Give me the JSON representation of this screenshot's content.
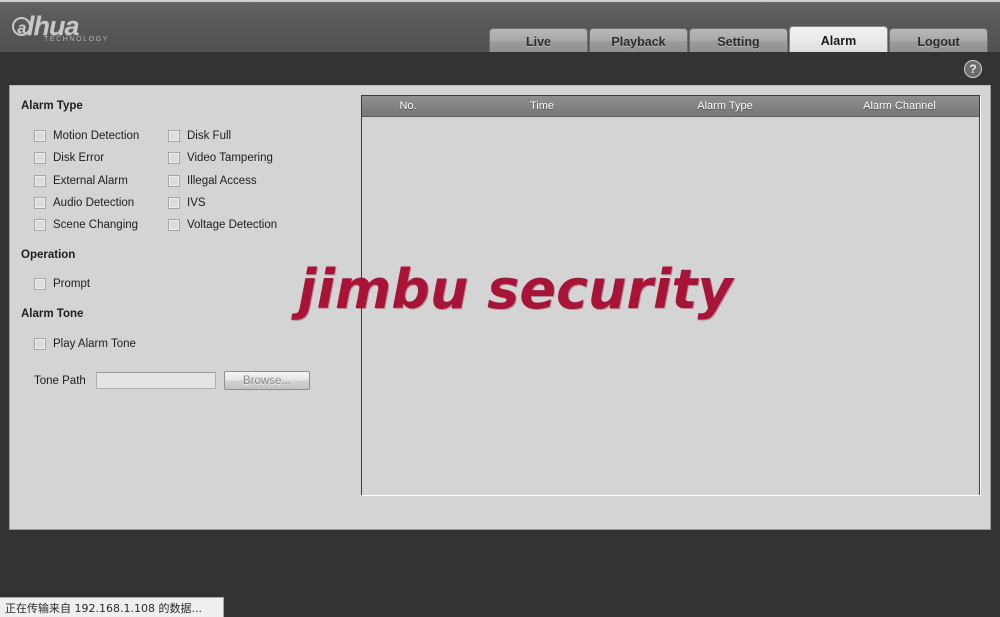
{
  "header": {
    "logo_mark": "a",
    "logo_name": "lhua",
    "logo_sub": "TECHNOLOGY",
    "help_icon": "?",
    "tabs": [
      {
        "label": "Live",
        "active": false
      },
      {
        "label": "Playback",
        "active": false
      },
      {
        "label": "Setting",
        "active": false
      },
      {
        "label": "Alarm",
        "active": true
      },
      {
        "label": "Logout",
        "active": false
      }
    ]
  },
  "left_pane": {
    "alarm_type_title": "Alarm Type",
    "alarm_types_col1": [
      {
        "label": "Motion Detection",
        "checked": false
      },
      {
        "label": "Disk Error",
        "checked": false
      },
      {
        "label": "External Alarm",
        "checked": false
      },
      {
        "label": "Audio Detection",
        "checked": false
      },
      {
        "label": "Scene Changing",
        "checked": false
      }
    ],
    "alarm_types_col2": [
      {
        "label": "Disk Full",
        "checked": false
      },
      {
        "label": "Video Tampering",
        "checked": false
      },
      {
        "label": "Illegal Access",
        "checked": false
      },
      {
        "label": "IVS",
        "checked": false
      },
      {
        "label": "Voltage Detection",
        "checked": false
      }
    ],
    "operation_title": "Operation",
    "prompt": {
      "label": "Prompt",
      "checked": false
    },
    "alarm_tone_title": "Alarm Tone",
    "play_alarm_tone": {
      "label": "Play Alarm Tone",
      "checked": false
    },
    "tone_path_label": "Tone Path",
    "tone_path_value": "",
    "tone_path_placeholder": "",
    "browse_label": "Browse..."
  },
  "table": {
    "columns": [
      "No.",
      "Time",
      "Alarm Type",
      "Alarm Channel"
    ],
    "rows": []
  },
  "watermark": "jimbu security",
  "statusbar": {
    "text": "正在传输来自 192.168.1.108 的数据..."
  },
  "colors": {
    "header_bg": "#575757",
    "panel_bg": "#d4d4d4",
    "dark_bg": "#333333",
    "table_header_bg": "#838383",
    "watermark": "#a81338",
    "active_tab_bg": "#e8e8e8"
  }
}
